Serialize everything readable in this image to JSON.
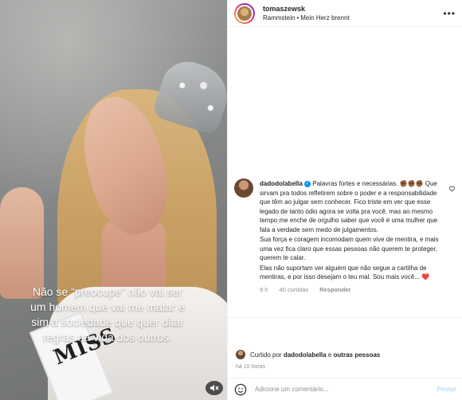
{
  "header": {
    "username": "tomaszewsk",
    "audio_artist": "Rammstein",
    "audio_separator": "•",
    "audio_track": "Mein Herz brennt",
    "more_icon": "more-horizontal-icon"
  },
  "media": {
    "caption": "Não se “preocupe” não vai ser um homem que vai me matar e sim a sociedade que quer ditar regras na vida dos outros.",
    "sash_text": "MISS",
    "mute_icon": "speaker-muted-icon"
  },
  "comment": {
    "username": "dadodolabella",
    "verified_icon": "verified-badge-icon",
    "line1": "Palavras fortes e necessárias. ✊🏾✊🏾✊🏾 Que sirvam pra todos refletirem sobre o poder e a responsabilidade que têm ao julgar sem conhecer. Fico triste em ver que esse legado de tanto ódio agora se volta pra você, mas ao mesmo tempo me enche de orgulho saber que você é uma mulher que fala a verdade sem medo de julgamentos.",
    "line2": "Sua força e coragem incomodam quem vive de mentira, e mais uma vez fica claro que essas pessoas não querem te proteger, querem te calar.",
    "line3": "Elas não suportam ver alguém que não segue a cartilha de mentiras, e por isso desejam o teu mal. Sou mais você...",
    "end_emoji": "❤️",
    "time": "9 h",
    "likes": "40 curtidas",
    "reply": "Responder",
    "heart_icon": "heart-outline-icon"
  },
  "likes": {
    "prefix": "Curtido por",
    "user": "dadodolabella",
    "conjunction": "e",
    "others": "outras pessoas"
  },
  "post_time": "há 10 horas",
  "comment_box": {
    "placeholder": "Adicione um comentário...",
    "post_label": "Postar",
    "emoji_icon": "emoji-smile-icon"
  },
  "colors": {
    "verified": "#0095f6",
    "post_button": "#b2dffc",
    "heart_red": "#e0245e",
    "muted_text": "#8e8e8e"
  }
}
